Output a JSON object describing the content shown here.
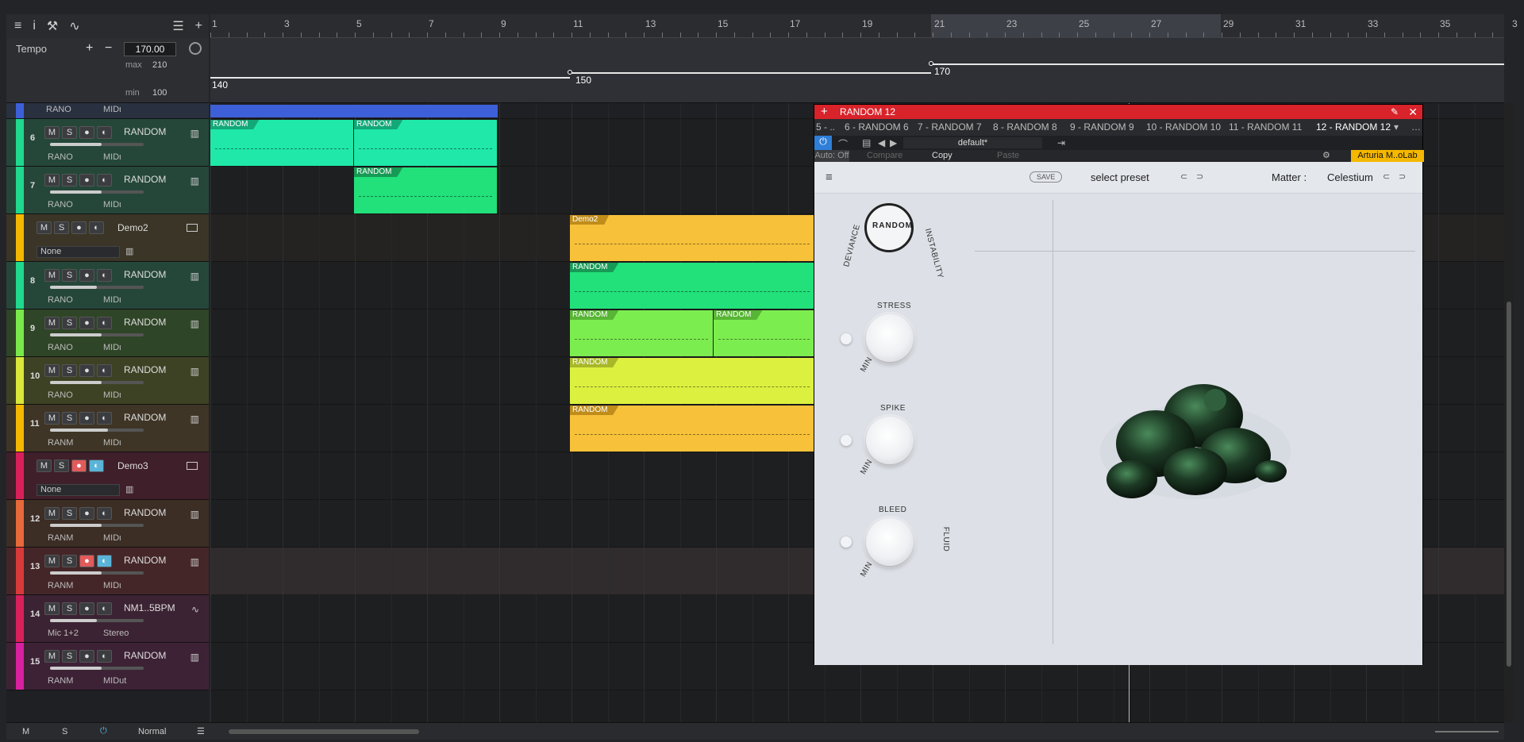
{
  "ruler": {
    "bars": [
      "1",
      "3",
      "5",
      "7",
      "9",
      "11",
      "13",
      "15",
      "17",
      "19",
      "21",
      "23",
      "25",
      "27",
      "29",
      "31",
      "33",
      "35",
      "3"
    ]
  },
  "tempo": {
    "label": "Tempo",
    "plus": "+",
    "minus": "−",
    "value": "170.00",
    "max_label": "max",
    "max": "210",
    "min_label": "min",
    "min": "100",
    "points": [
      "140",
      "150",
      "170"
    ]
  },
  "tracks": [
    {
      "num": "",
      "name": "",
      "io1": "RANO",
      "io2": "MIDι"
    },
    {
      "num": "6",
      "name": "RANDOM",
      "io1": "RANO",
      "io2": "MIDι",
      "fader": 0.55
    },
    {
      "num": "7",
      "name": "RANDOM",
      "io1": "RANO",
      "io2": "MIDι",
      "fader": 0.55
    },
    {
      "num": "",
      "name": "Demo2",
      "folder_sel": "None"
    },
    {
      "num": "8",
      "name": "RANDOM",
      "io1": "RANO",
      "io2": "MIDι",
      "fader": 0.5
    },
    {
      "num": "9",
      "name": "RANDOM",
      "io1": "RANO",
      "io2": "MIDι",
      "fader": 0.55
    },
    {
      "num": "10",
      "name": "RANDOM",
      "io1": "RANO",
      "io2": "MIDι",
      "fader": 0.55
    },
    {
      "num": "11",
      "name": "RANDOM",
      "io1": "RANM",
      "io2": "MIDι",
      "fader": 0.62
    },
    {
      "num": "",
      "name": "Demo3",
      "folder_sel": "None"
    },
    {
      "num": "12",
      "name": "RANDOM",
      "io1": "RANM",
      "io2": "MIDι",
      "fader": 0.55
    },
    {
      "num": "13",
      "name": "RANDOM",
      "io1": "RANM",
      "io2": "MIDι",
      "fader": 0.55
    },
    {
      "num": "14",
      "name": "NM1..5BPM",
      "io1": "Mic 1+2",
      "io2": "Stereo",
      "fader": 0.5
    },
    {
      "num": "15",
      "name": "RANDOM",
      "io1": "RANM",
      "io2": "MIDut",
      "fader": 0.55
    }
  ],
  "buttons": {
    "m": "M",
    "s": "S"
  },
  "clips": {
    "random": "RANDOM",
    "demo2": "Demo2"
  },
  "plugin": {
    "title": "RANDOM 12",
    "tabs": [
      "5 - ..",
      "6 - RANDOM 6",
      "7 - RANDOM 7",
      "8 - RANDOM 8",
      "9 - RANDOM 9",
      "10 - RANDOM 10",
      "11 - RANDOM 11",
      "12 - RANDOM 12"
    ],
    "preset": "default*",
    "auto": "Auto: Off",
    "compare": "Compare",
    "copy": "Copy",
    "paste": "Paste",
    "vendor": "Arturia M..oLab",
    "save": "SAVE",
    "select_preset": "select preset",
    "matter_label": "Matter :",
    "matter_value": "Celestium",
    "deviance": "DEVIANCE",
    "instability": "INSTABILITY",
    "stress": "STRESS",
    "spike": "SPIKE",
    "bleed": "BLEED",
    "fluid": "FLUID",
    "min": "MIN",
    "logo": "RANDOM"
  },
  "bottom": {
    "m": "M",
    "s": "S",
    "mode": "Normal"
  },
  "colors": {
    "accent": "#d8232a",
    "vendor": "#f5b800"
  }
}
